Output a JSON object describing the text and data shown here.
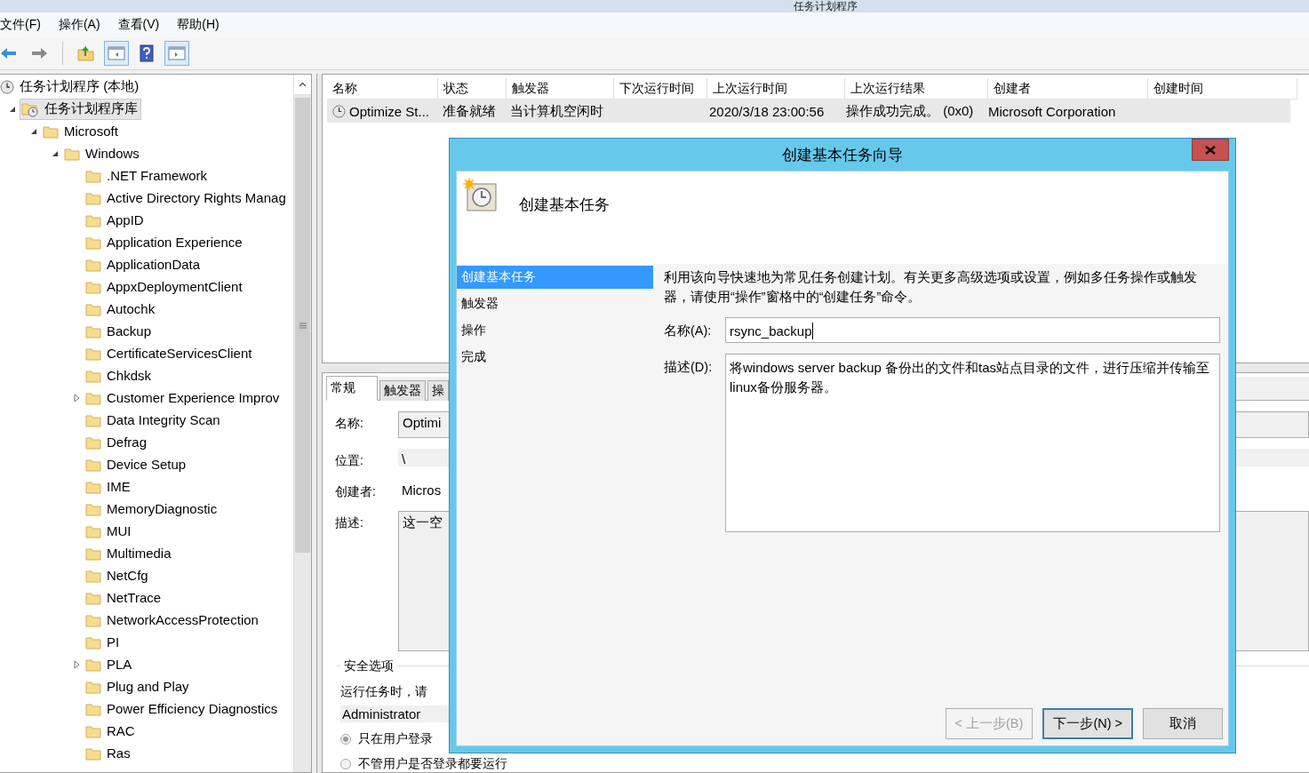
{
  "window": {
    "title": "任务计划程序"
  },
  "menu": [
    "文件(F)",
    "操作(A)",
    "查看(V)",
    "帮助(H)"
  ],
  "toolbar": [
    {
      "kind": "back"
    },
    {
      "kind": "forward"
    },
    {
      "kind": "separator"
    },
    {
      "kind": "up"
    },
    {
      "kind": "tree-pane",
      "pressed": true
    },
    {
      "kind": "help"
    },
    {
      "kind": "action-pane",
      "pressed": true
    }
  ],
  "tree": [
    {
      "label": "任务计划程序 (本地)",
      "kind": "root",
      "selected": false,
      "children": [
        {
          "label": "任务计划程序库",
          "kind": "library",
          "selected": true,
          "expandable": true,
          "expanded": true,
          "children": [
            {
              "label": "Microsoft",
              "kind": "folder",
              "selected": false,
              "expandable": true,
              "expanded": true,
              "children": [
                {
                  "label": "Windows",
                  "kind": "folder",
                  "selected": false,
                  "expandable": true,
                  "expanded": true,
                  "children": [
                    {
                      "label": ".NET Framework",
                      "kind": "folder",
                      "selected": false,
                      "expandable": false,
                      "expanded": false
                    },
                    {
                      "label": "Active Directory Rights Manag",
                      "kind": "folder",
                      "selected": false,
                      "expandable": false,
                      "expanded": false
                    },
                    {
                      "label": "AppID",
                      "kind": "folder",
                      "selected": false,
                      "expandable": false,
                      "expanded": false
                    },
                    {
                      "label": "Application Experience",
                      "kind": "folder",
                      "selected": false,
                      "expandable": false,
                      "expanded": false
                    },
                    {
                      "label": "ApplicationData",
                      "kind": "folder",
                      "selected": false,
                      "expandable": false,
                      "expanded": false
                    },
                    {
                      "label": "AppxDeploymentClient",
                      "kind": "folder",
                      "selected": false,
                      "expandable": false,
                      "expanded": false
                    },
                    {
                      "label": "Autochk",
                      "kind": "folder",
                      "selected": false,
                      "expandable": false,
                      "expanded": false
                    },
                    {
                      "label": "Backup",
                      "kind": "folder",
                      "selected": false,
                      "expandable": false,
                      "expanded": false
                    },
                    {
                      "label": "CertificateServicesClient",
                      "kind": "folder",
                      "selected": false,
                      "expandable": false,
                      "expanded": false
                    },
                    {
                      "label": "Chkdsk",
                      "kind": "folder",
                      "selected": false,
                      "expandable": false,
                      "expanded": false
                    },
                    {
                      "label": "Customer Experience Improv",
                      "kind": "folder",
                      "selected": false,
                      "expandable": true,
                      "expanded": false
                    },
                    {
                      "label": "Data Integrity Scan",
                      "kind": "folder",
                      "selected": false,
                      "expandable": false,
                      "expanded": false
                    },
                    {
                      "label": "Defrag",
                      "kind": "folder",
                      "selected": false,
                      "expandable": false,
                      "expanded": false
                    },
                    {
                      "label": "Device Setup",
                      "kind": "folder",
                      "selected": false,
                      "expandable": false,
                      "expanded": false
                    },
                    {
                      "label": "IME",
                      "kind": "folder",
                      "selected": false,
                      "expandable": false,
                      "expanded": false
                    },
                    {
                      "label": "MemoryDiagnostic",
                      "kind": "folder",
                      "selected": false,
                      "expandable": false,
                      "expanded": false
                    },
                    {
                      "label": "MUI",
                      "kind": "folder",
                      "selected": false,
                      "expandable": false,
                      "expanded": false
                    },
                    {
                      "label": "Multimedia",
                      "kind": "folder",
                      "selected": false,
                      "expandable": false,
                      "expanded": false
                    },
                    {
                      "label": "NetCfg",
                      "kind": "folder",
                      "selected": false,
                      "expandable": false,
                      "expanded": false
                    },
                    {
                      "label": "NetTrace",
                      "kind": "folder",
                      "selected": false,
                      "expandable": false,
                      "expanded": false
                    },
                    {
                      "label": "NetworkAccessProtection",
                      "kind": "folder",
                      "selected": false,
                      "expandable": false,
                      "expanded": false
                    },
                    {
                      "label": "PI",
                      "kind": "folder",
                      "selected": false,
                      "expandable": false,
                      "expanded": false
                    },
                    {
                      "label": "PLA",
                      "kind": "folder",
                      "selected": false,
                      "expandable": true,
                      "expanded": false
                    },
                    {
                      "label": "Plug and Play",
                      "kind": "folder",
                      "selected": false,
                      "expandable": false,
                      "expanded": false
                    },
                    {
                      "label": "Power Efficiency Diagnostics",
                      "kind": "folder",
                      "selected": false,
                      "expandable": false,
                      "expanded": false
                    },
                    {
                      "label": "RAC",
                      "kind": "folder",
                      "selected": false,
                      "expandable": false,
                      "expanded": false
                    },
                    {
                      "label": "Ras",
                      "kind": "folder",
                      "selected": false,
                      "expandable": false,
                      "expanded": false
                    }
                  ]
                }
              ]
            }
          ]
        }
      ]
    }
  ],
  "task_list": {
    "columns": [
      "名称",
      "状态",
      "触发器",
      "下次运行时间",
      "上次运行时间",
      "上次运行结果",
      "创建者",
      "创建时间"
    ],
    "rows": [
      {
        "selected": true,
        "cells": [
          "Optimize St...",
          "准备就绪",
          "当计算机空闲时",
          null,
          "2020/3/18 23:00:56",
          "操作成功完成。 (0x0)",
          "Microsoft Corporation",
          null
        ]
      }
    ]
  },
  "details": {
    "tabs": [
      {
        "label": "常规",
        "selected": true
      },
      {
        "label": "触发器",
        "selected": false
      },
      {
        "label": "操",
        "selected": false
      }
    ],
    "name_label": "名称:",
    "name_value": "Optimi",
    "location_label": "位置:",
    "location_value": "\\",
    "author_label": "创建者:",
    "author_value": "Micros",
    "description_label": "描述:",
    "description_value": "这一空",
    "security": {
      "title": "安全选项",
      "text": "运行任务时，请",
      "account": "Administrator",
      "options": [
        {
          "label": "只在用户登录",
          "selected": true
        },
        {
          "label": "不管用户是否登录都要运行",
          "selected": false
        }
      ]
    }
  },
  "dialog": {
    "title": "创建基本任务向导",
    "heading": "创建基本任务",
    "steps": [
      {
        "label": "创建基本任务",
        "selected": true
      },
      {
        "label": "触发器",
        "selected": false
      },
      {
        "label": "操作",
        "selected": false
      },
      {
        "label": "完成",
        "selected": false
      }
    ],
    "intro": "利用该向导快速地为常见任务创建计划。有关更多高级选项或设置，例如多任务操作或触发器，请使用“操作”窗格中的“创建任务”命令。",
    "name_label": "名称(A):",
    "name_value": "rsync_backup",
    "description_label": "描述(D):",
    "description_value": "将windows server backup 备份出的文件和tas站点目录的文件，进行压缩并传输至linux备份服务器。",
    "buttons": [
      {
        "label": "< 上一步(B)",
        "disabled": true,
        "focused": false
      },
      {
        "label": "下一步(N) >",
        "disabled": false,
        "focused": true
      },
      {
        "label": "取消",
        "disabled": false,
        "focused": false
      }
    ]
  }
}
